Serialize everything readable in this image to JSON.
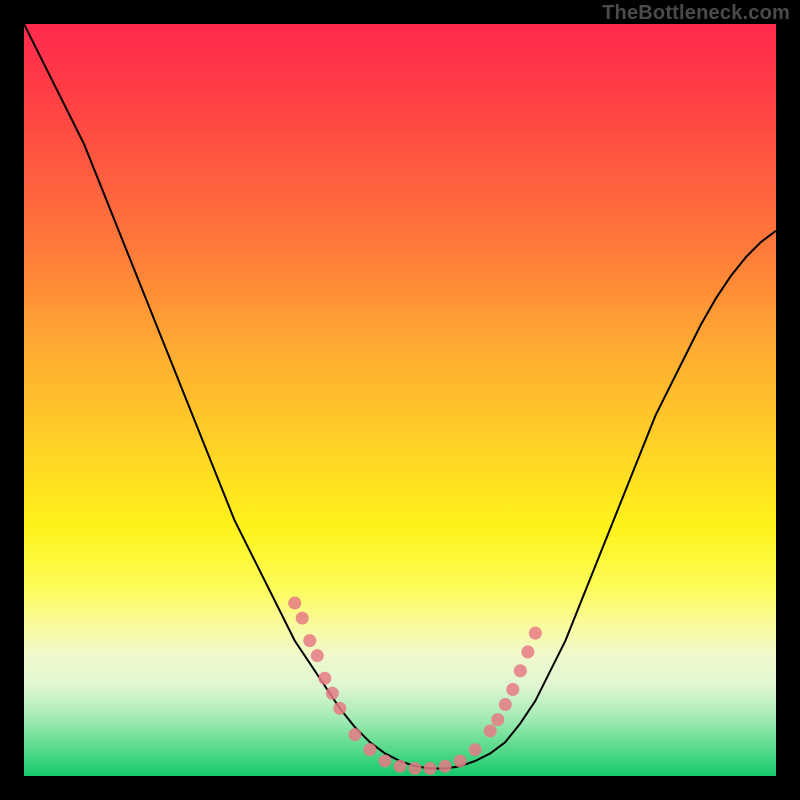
{
  "watermark": "TheBottleneck.com",
  "chart_data": {
    "type": "line",
    "title": "",
    "xlabel": "",
    "ylabel": "",
    "xlim": [
      0,
      100
    ],
    "ylim": [
      0,
      100
    ],
    "series": [
      {
        "name": "curve",
        "color": "#000000",
        "x": [
          0,
          2,
          4,
          6,
          8,
          10,
          12,
          14,
          16,
          18,
          20,
          22,
          24,
          26,
          28,
          30,
          32,
          34,
          36,
          38,
          40,
          42,
          44,
          46,
          48,
          50,
          52,
          54,
          56,
          58,
          60,
          62,
          64,
          66,
          68,
          70,
          72,
          74,
          76,
          78,
          80,
          82,
          84,
          86,
          88,
          90,
          92,
          94,
          96,
          98,
          100
        ],
        "y": [
          100,
          96,
          92,
          88,
          84,
          79,
          74,
          69,
          64,
          59,
          54,
          49,
          44,
          39,
          34,
          30,
          26,
          22,
          18,
          15,
          12,
          9,
          6.5,
          4.5,
          3,
          2,
          1.3,
          1,
          1,
          1.3,
          2,
          3,
          4.5,
          7,
          10,
          14,
          18,
          23,
          28,
          33,
          38,
          43,
          48,
          52,
          56,
          60,
          63.5,
          66.5,
          69,
          71,
          72.5
        ]
      },
      {
        "name": "markers",
        "type": "scatter",
        "color": "#e67a86",
        "x": [
          36,
          37,
          38,
          39,
          40,
          41,
          42,
          44,
          46,
          48,
          50,
          52,
          54,
          56,
          58,
          60,
          62,
          63,
          64,
          65,
          66,
          67,
          68
        ],
        "y": [
          23,
          21,
          18,
          16,
          13,
          11,
          9,
          5.5,
          3.5,
          2,
          1.3,
          1,
          1,
          1.3,
          2,
          3.5,
          6,
          7.5,
          9.5,
          11.5,
          14,
          16.5,
          19
        ]
      }
    ],
    "notes": "Axes are unlabeled in the source image; x spans 0–100 arbitrary units, y spans 0 (bottom) to 100 (top). Curve is a V-shaped bottleneck profile with minimum near x≈55. Pink scatter markers cluster on both legs near the trough."
  }
}
